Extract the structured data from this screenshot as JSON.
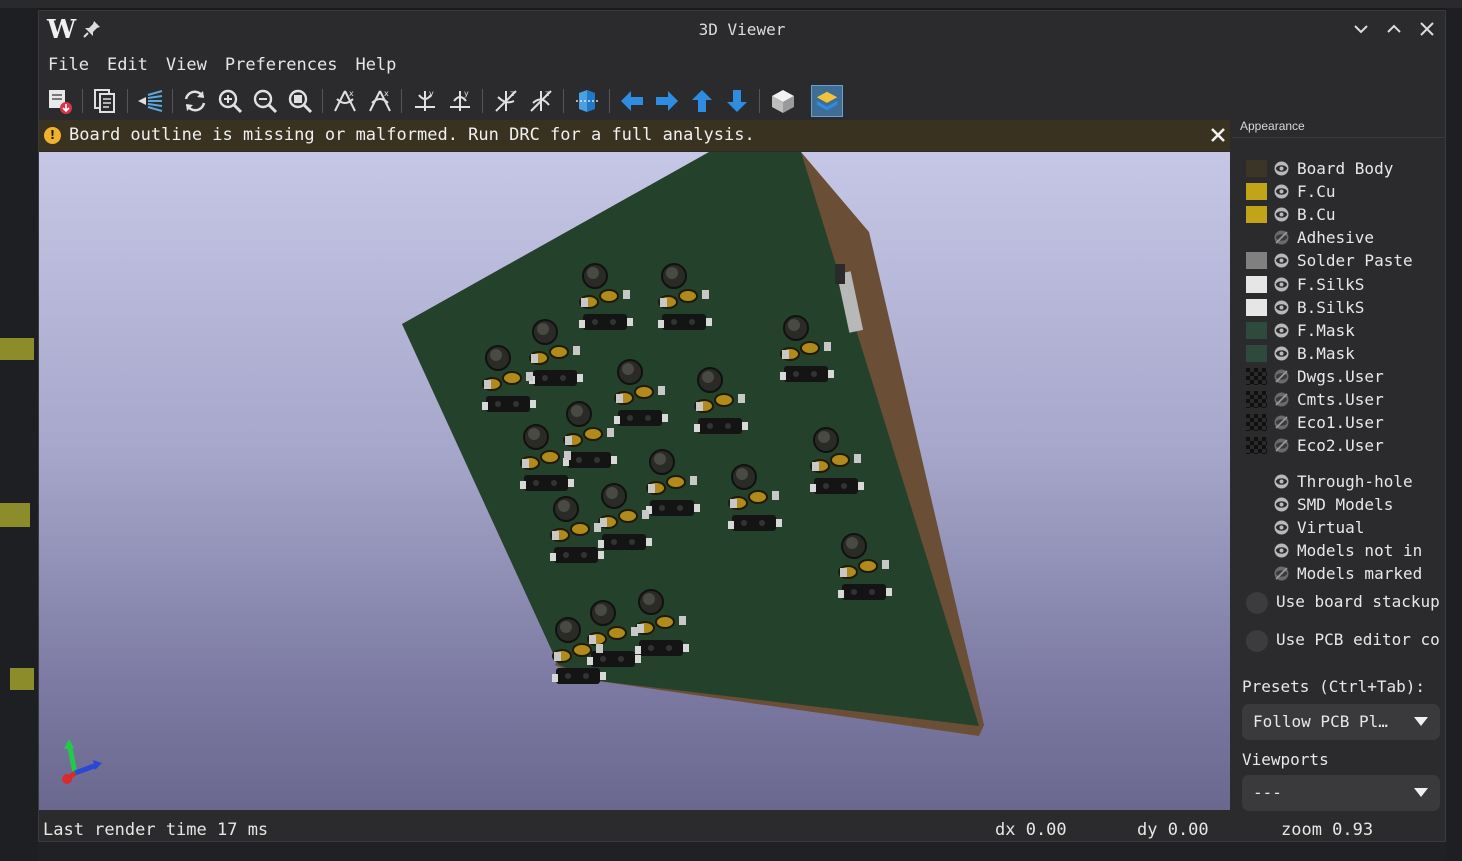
{
  "window": {
    "title": "3D Viewer",
    "logo": "W"
  },
  "menu": [
    "File",
    "Edit",
    "View",
    "Preferences",
    "Help"
  ],
  "toolbar": {
    "icons": [
      "render-raytraced-icon",
      "copy-image-icon",
      "render-options-icon",
      "reload-board-icon",
      "zoom-in-icon",
      "zoom-out-icon",
      "zoom-fit-icon",
      "rotate-x-cw-icon",
      "rotate-x-ccw-icon",
      "rotate-y-cw-icon",
      "rotate-y-ccw-icon",
      "rotate-z-cw-icon",
      "rotate-z-ccw-icon",
      "flip-board-icon",
      "pan-left-icon",
      "pan-right-icon",
      "pan-up-icon",
      "pan-down-icon",
      "orthographic-icon",
      "show-layers-manager-icon"
    ],
    "active": "show-layers-manager-icon"
  },
  "infobar": {
    "message": "Board outline is missing or malformed. Run DRC for a full analysis.",
    "warning_color": "#f0b030"
  },
  "status": {
    "render_time": "Last render time 17 ms",
    "dx": "dx 0.00",
    "dy": "dy 0.00",
    "zoom": "zoom 0.93"
  },
  "appearance": {
    "header": "Appearance",
    "layers": [
      {
        "label": "Board Body",
        "color": "#3a3527",
        "visible": true
      },
      {
        "label": "F.Cu",
        "color": "#c2a418",
        "visible": true
      },
      {
        "label": "B.Cu",
        "color": "#c2a418",
        "visible": true
      },
      {
        "label": "Adhesive",
        "color": "",
        "visible": false
      },
      {
        "label": "Solder Paste",
        "color": "#808080",
        "visible": true
      },
      {
        "label": "F.SilkS",
        "color": "#e6e6e6",
        "visible": true
      },
      {
        "label": "B.SilkS",
        "color": "#e6e6e6",
        "visible": true
      },
      {
        "label": "F.Mask",
        "color": "#2e4a3c",
        "visible": true
      },
      {
        "label": "B.Mask",
        "color": "#2e4a3c",
        "visible": true
      },
      {
        "label": "Dwgs.User",
        "color": "checker",
        "visible": false
      },
      {
        "label": "Cmts.User",
        "color": "checker",
        "visible": false
      },
      {
        "label": "Eco1.User",
        "color": "checker",
        "visible": false
      },
      {
        "label": "Eco2.User",
        "color": "checker",
        "visible": false
      }
    ],
    "models": [
      {
        "label": "Through-hole",
        "visible": true
      },
      {
        "label": "SMD Models",
        "visible": true
      },
      {
        "label": "Virtual",
        "visible": true
      },
      {
        "label": "Models not in",
        "visible": true
      },
      {
        "label": "Models marked",
        "visible": false
      }
    ],
    "options": [
      "Use board stackup",
      "Use PCB editor co"
    ],
    "presets_label": "Presets (Ctrl+Tab):",
    "presets_value": "Follow PCB Pl…",
    "viewports_label": "Viewports",
    "viewports_value": "---"
  }
}
